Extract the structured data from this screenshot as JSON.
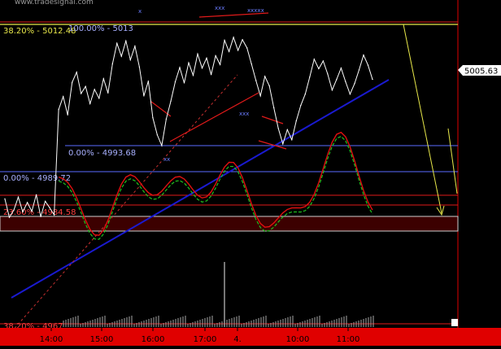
{
  "header": {
    "site_text": "www.tradesignal.com"
  },
  "price_tag": "5005.63",
  "fib_labels": {
    "top": "38.20% - 5012.48",
    "high": "100.00% - 5013",
    "mid": "0.00% - 4993.68",
    "left": "0.00% - 4989.72",
    "red": "23.60% - 4984.58",
    "bottom": "38.20% - 4967"
  },
  "x_axis": {
    "ticks": [
      "14:00",
      "15:00",
      "16:00",
      "17:00",
      "4.",
      "10:00",
      "11:00"
    ]
  },
  "colors": {
    "background": "#000000",
    "price": "#ffffff",
    "fib_yellow": "#e8e84a",
    "fib_blue": "#5a6cff",
    "fib_red": "#e01a1a",
    "trend_blue": "#1a1ad0",
    "oscillator_red": "#e01010",
    "oscillator_green": "#1fc21f",
    "axis_bar": "#e00000",
    "volume": "#a8a8a8",
    "arrow": "#e8e84a"
  },
  "chart_data": {
    "type": "line",
    "title": "",
    "xlabel": "",
    "ylabel": "",
    "ylim": [
      4965,
      5016
    ],
    "x_ticks": [
      "14:00",
      "15:00",
      "16:00",
      "17:00",
      "4.",
      "10:00",
      "11:00"
    ],
    "grid": false,
    "fib_levels": [
      {
        "label": "38.20% - 5012.48",
        "value": 5012.48
      },
      {
        "label": "100.00% - 5013",
        "value": 5013
      },
      {
        "label": "0.00% - 4993.68",
        "value": 4993.68
      },
      {
        "label": "0.00% - 4989.72",
        "value": 4989.72
      },
      {
        "label": "23.60% - 4984.58",
        "value": 4984.58
      },
      {
        "label": "38.20% - 4967",
        "value": 4967
      }
    ],
    "last_price": 5005.63,
    "series": [
      {
        "values": [
          4986.1,
          4983.0,
          4984.2,
          4986.4,
          4983.9,
          4985.5,
          4984.0,
          4986.8,
          4983.1,
          4985.7,
          4984.6,
          4983.4,
          5001.2,
          5003.4,
          5000.3,
          5005.8,
          5007.5,
          5003.9,
          5005.1,
          5002.2,
          5004.6,
          5003.1,
          5006.4,
          5004.0,
          5008.9,
          5012.4,
          5010.2,
          5012.8,
          5009.6,
          5011.9,
          5008.4,
          5003.5,
          5006.0,
          4999.8,
          4996.9,
          4995.1,
          4999.6,
          5002.6,
          5005.9,
          5008.3,
          5005.7,
          5009.1,
          5007.0,
          5010.6,
          5008.2,
          5009.9,
          5007.1,
          5010.3,
          5008.8,
          5012.9,
          5011.0,
          5013.4,
          5011.2,
          5013.0,
          5011.6,
          5008.9,
          5006.1,
          5003.5,
          5006.8,
          5005.2,
          5001.5,
          4998.0,
          4995.4,
          4997.8,
          4996.1,
          4999.3,
          5001.9,
          5003.8,
          5006.7,
          5009.7,
          5008.1,
          5009.4,
          5007.2,
          5004.5,
          5006.3,
          5008.2,
          5005.9,
          5003.8,
          5005.6,
          5007.9,
          5010.4,
          5008.7,
          5006.3
        ]
      }
    ]
  }
}
